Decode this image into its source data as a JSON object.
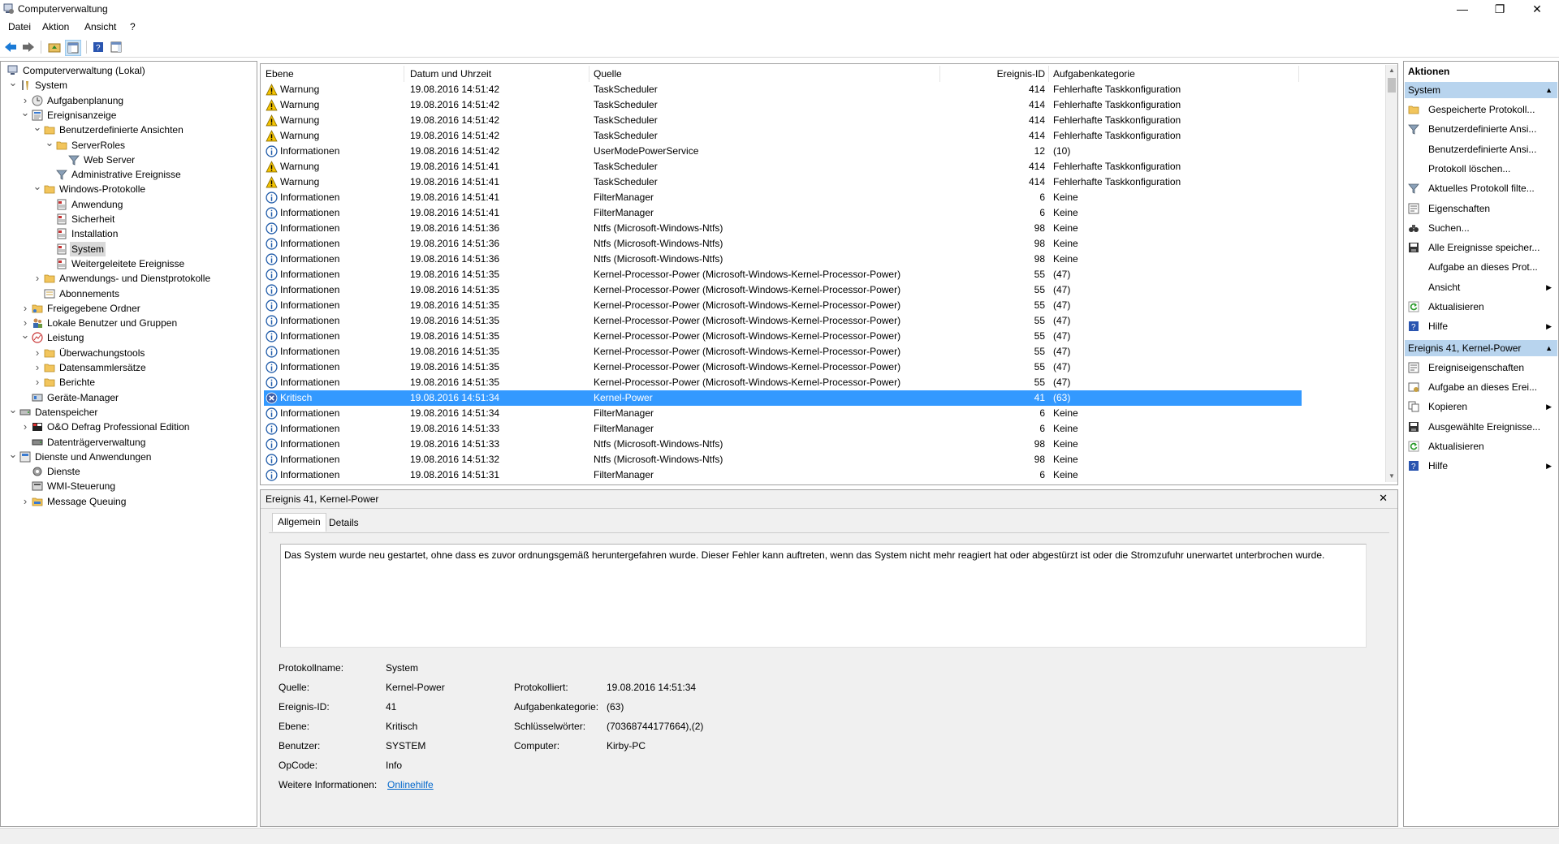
{
  "window": {
    "title": "Computerverwaltung",
    "minimize": "—",
    "maximize": "❐",
    "close": "✕"
  },
  "menu": [
    "Datei",
    "Aktion",
    "Ansicht",
    "?"
  ],
  "tree": [
    {
      "label": "Computerverwaltung (Lokal)",
      "level": 0,
      "exp": "",
      "icon": "computer-icon"
    },
    {
      "label": "System",
      "level": 1,
      "exp": "v",
      "icon": "tools-icon"
    },
    {
      "label": "Aufgabenplanung",
      "level": 2,
      "exp": ">",
      "icon": "clock-icon"
    },
    {
      "label": "Ereignisanzeige",
      "level": 2,
      "exp": "v",
      "icon": "event-viewer-icon"
    },
    {
      "label": "Benutzerdefinierte Ansichten",
      "level": 3,
      "exp": "v",
      "icon": "folder-icon"
    },
    {
      "label": "ServerRoles",
      "level": 4,
      "exp": "v",
      "icon": "folder-icon"
    },
    {
      "label": "Web Server",
      "level": 5,
      "exp": "",
      "icon": "filter-icon"
    },
    {
      "label": "Administrative Ereignisse",
      "level": 4,
      "exp": "",
      "icon": "filter-icon"
    },
    {
      "label": "Windows-Protokolle",
      "level": 3,
      "exp": "v",
      "icon": "log-folder-icon"
    },
    {
      "label": "Anwendung",
      "level": 4,
      "exp": "",
      "icon": "log-icon"
    },
    {
      "label": "Sicherheit",
      "level": 4,
      "exp": "",
      "icon": "log-icon"
    },
    {
      "label": "Installation",
      "level": 4,
      "exp": "",
      "icon": "log-icon"
    },
    {
      "label": "System",
      "level": 4,
      "exp": "",
      "icon": "log-icon",
      "selected": true
    },
    {
      "label": "Weitergeleitete Ereignisse",
      "level": 4,
      "exp": "",
      "icon": "log-icon"
    },
    {
      "label": "Anwendungs- und Dienstprotokolle",
      "level": 3,
      "exp": ">",
      "icon": "folder-icon"
    },
    {
      "label": "Abonnements",
      "level": 3,
      "exp": "",
      "icon": "subscription-icon"
    },
    {
      "label": "Freigegebene Ordner",
      "level": 2,
      "exp": ">",
      "icon": "shared-folder-icon"
    },
    {
      "label": "Lokale Benutzer und Gruppen",
      "level": 2,
      "exp": ">",
      "icon": "users-icon"
    },
    {
      "label": "Leistung",
      "level": 2,
      "exp": "v",
      "icon": "performance-icon"
    },
    {
      "label": "Überwachungstools",
      "level": 3,
      "exp": ">",
      "icon": "folder-icon"
    },
    {
      "label": "Datensammlersätze",
      "level": 3,
      "exp": ">",
      "icon": "folder-icon"
    },
    {
      "label": "Berichte",
      "level": 3,
      "exp": ">",
      "icon": "folder-icon"
    },
    {
      "label": "Geräte-Manager",
      "level": 2,
      "exp": "",
      "icon": "device-manager-icon"
    },
    {
      "label": "Datenspeicher",
      "level": 1,
      "exp": "v",
      "icon": "storage-icon"
    },
    {
      "label": "O&O Defrag Professional Edition",
      "level": 2,
      "exp": ">",
      "icon": "defrag-icon"
    },
    {
      "label": "Datenträgerverwaltung",
      "level": 2,
      "exp": "",
      "icon": "disk-icon"
    },
    {
      "label": "Dienste und Anwendungen",
      "level": 1,
      "exp": "v",
      "icon": "services-apps-icon"
    },
    {
      "label": "Dienste",
      "level": 2,
      "exp": "",
      "icon": "gear-icon"
    },
    {
      "label": "WMI-Steuerung",
      "level": 2,
      "exp": "",
      "icon": "wmi-icon"
    },
    {
      "label": "Message Queuing",
      "level": 2,
      "exp": ">",
      "icon": "queue-icon"
    }
  ],
  "columns": [
    "Ebene",
    "Datum und Uhrzeit",
    "Quelle",
    "Ereignis-ID",
    "Aufgabenkategorie"
  ],
  "events": [
    {
      "level": "Warnung",
      "type": "warn",
      "date": "19.08.2016 14:51:42",
      "source": "TaskScheduler",
      "id": "414",
      "cat": "Fehlerhafte Taskkonfiguration"
    },
    {
      "level": "Warnung",
      "type": "warn",
      "date": "19.08.2016 14:51:42",
      "source": "TaskScheduler",
      "id": "414",
      "cat": "Fehlerhafte Taskkonfiguration"
    },
    {
      "level": "Warnung",
      "type": "warn",
      "date": "19.08.2016 14:51:42",
      "source": "TaskScheduler",
      "id": "414",
      "cat": "Fehlerhafte Taskkonfiguration"
    },
    {
      "level": "Warnung",
      "type": "warn",
      "date": "19.08.2016 14:51:42",
      "source": "TaskScheduler",
      "id": "414",
      "cat": "Fehlerhafte Taskkonfiguration"
    },
    {
      "level": "Informationen",
      "type": "info",
      "date": "19.08.2016 14:51:42",
      "source": "UserModePowerService",
      "id": "12",
      "cat": "(10)"
    },
    {
      "level": "Warnung",
      "type": "warn",
      "date": "19.08.2016 14:51:41",
      "source": "TaskScheduler",
      "id": "414",
      "cat": "Fehlerhafte Taskkonfiguration"
    },
    {
      "level": "Warnung",
      "type": "warn",
      "date": "19.08.2016 14:51:41",
      "source": "TaskScheduler",
      "id": "414",
      "cat": "Fehlerhafte Taskkonfiguration"
    },
    {
      "level": "Informationen",
      "type": "info",
      "date": "19.08.2016 14:51:41",
      "source": "FilterManager",
      "id": "6",
      "cat": "Keine"
    },
    {
      "level": "Informationen",
      "type": "info",
      "date": "19.08.2016 14:51:41",
      "source": "FilterManager",
      "id": "6",
      "cat": "Keine"
    },
    {
      "level": "Informationen",
      "type": "info",
      "date": "19.08.2016 14:51:36",
      "source": "Ntfs (Microsoft-Windows-Ntfs)",
      "id": "98",
      "cat": "Keine"
    },
    {
      "level": "Informationen",
      "type": "info",
      "date": "19.08.2016 14:51:36",
      "source": "Ntfs (Microsoft-Windows-Ntfs)",
      "id": "98",
      "cat": "Keine"
    },
    {
      "level": "Informationen",
      "type": "info",
      "date": "19.08.2016 14:51:36",
      "source": "Ntfs (Microsoft-Windows-Ntfs)",
      "id": "98",
      "cat": "Keine"
    },
    {
      "level": "Informationen",
      "type": "info",
      "date": "19.08.2016 14:51:35",
      "source": "Kernel-Processor-Power (Microsoft-Windows-Kernel-Processor-Power)",
      "id": "55",
      "cat": "(47)"
    },
    {
      "level": "Informationen",
      "type": "info",
      "date": "19.08.2016 14:51:35",
      "source": "Kernel-Processor-Power (Microsoft-Windows-Kernel-Processor-Power)",
      "id": "55",
      "cat": "(47)"
    },
    {
      "level": "Informationen",
      "type": "info",
      "date": "19.08.2016 14:51:35",
      "source": "Kernel-Processor-Power (Microsoft-Windows-Kernel-Processor-Power)",
      "id": "55",
      "cat": "(47)"
    },
    {
      "level": "Informationen",
      "type": "info",
      "date": "19.08.2016 14:51:35",
      "source": "Kernel-Processor-Power (Microsoft-Windows-Kernel-Processor-Power)",
      "id": "55",
      "cat": "(47)"
    },
    {
      "level": "Informationen",
      "type": "info",
      "date": "19.08.2016 14:51:35",
      "source": "Kernel-Processor-Power (Microsoft-Windows-Kernel-Processor-Power)",
      "id": "55",
      "cat": "(47)"
    },
    {
      "level": "Informationen",
      "type": "info",
      "date": "19.08.2016 14:51:35",
      "source": "Kernel-Processor-Power (Microsoft-Windows-Kernel-Processor-Power)",
      "id": "55",
      "cat": "(47)"
    },
    {
      "level": "Informationen",
      "type": "info",
      "date": "19.08.2016 14:51:35",
      "source": "Kernel-Processor-Power (Microsoft-Windows-Kernel-Processor-Power)",
      "id": "55",
      "cat": "(47)"
    },
    {
      "level": "Informationen",
      "type": "info",
      "date": "19.08.2016 14:51:35",
      "source": "Kernel-Processor-Power (Microsoft-Windows-Kernel-Processor-Power)",
      "id": "55",
      "cat": "(47)"
    },
    {
      "level": "Kritisch",
      "type": "crit",
      "date": "19.08.2016 14:51:34",
      "source": "Kernel-Power",
      "id": "41",
      "cat": "(63)",
      "selected": true
    },
    {
      "level": "Informationen",
      "type": "info",
      "date": "19.08.2016 14:51:34",
      "source": "FilterManager",
      "id": "6",
      "cat": "Keine"
    },
    {
      "level": "Informationen",
      "type": "info",
      "date": "19.08.2016 14:51:33",
      "source": "FilterManager",
      "id": "6",
      "cat": "Keine"
    },
    {
      "level": "Informationen",
      "type": "info",
      "date": "19.08.2016 14:51:33",
      "source": "Ntfs (Microsoft-Windows-Ntfs)",
      "id": "98",
      "cat": "Keine"
    },
    {
      "level": "Informationen",
      "type": "info",
      "date": "19.08.2016 14:51:32",
      "source": "Ntfs (Microsoft-Windows-Ntfs)",
      "id": "98",
      "cat": "Keine"
    },
    {
      "level": "Informationen",
      "type": "info",
      "date": "19.08.2016 14:51:31",
      "source": "FilterManager",
      "id": "6",
      "cat": "Keine"
    }
  ],
  "detail": {
    "title": "Ereignis 41, Kernel-Power",
    "close": "✕",
    "tabs": [
      "Allgemein",
      "Details"
    ],
    "description": "Das System wurde neu gestartet, ohne dass es zuvor ordnungsgemäß heruntergefahren wurde. Dieser Fehler kann auftreten, wenn das System nicht mehr reagiert hat oder abgestürzt ist oder die Stromzufuhr unerwartet unterbrochen wurde.",
    "props_left": [
      {
        "label": "Protokollname:",
        "value": "System"
      },
      {
        "label": "Quelle:",
        "value": "Kernel-Power"
      },
      {
        "label": "Ereignis-ID:",
        "value": "41"
      },
      {
        "label": "Ebene:",
        "value": "Kritisch"
      },
      {
        "label": "Benutzer:",
        "value": "SYSTEM"
      },
      {
        "label": "OpCode:",
        "value": "Info"
      },
      {
        "label": "Weitere Informationen:",
        "value": "Onlinehilfe",
        "link": true
      }
    ],
    "props_right": [
      {
        "label": "Protokolliert:",
        "value": "19.08.2016 14:51:34"
      },
      {
        "label": "Aufgabenkategorie:",
        "value": "(63)"
      },
      {
        "label": "Schlüsselwörter:",
        "value": "(70368744177664),(2)"
      },
      {
        "label": "Computer:",
        "value": "Kirby-PC"
      }
    ]
  },
  "actions": {
    "header": "Aktionen",
    "section1": "System",
    "items1": [
      {
        "label": "Gespeicherte Protokoll...",
        "icon": "open-log-icon"
      },
      {
        "label": "Benutzerdefinierte Ansi...",
        "icon": "filter-icon"
      },
      {
        "label": "Benutzerdefinierte Ansi...",
        "icon": ""
      },
      {
        "label": "Protokoll löschen...",
        "icon": ""
      },
      {
        "label": "Aktuelles Protokoll filte...",
        "icon": "filter-icon"
      },
      {
        "label": "Eigenschaften",
        "icon": "properties-icon"
      },
      {
        "label": "Suchen...",
        "icon": "binoculars-icon"
      },
      {
        "label": "Alle Ereignisse speicher...",
        "icon": "save-icon"
      },
      {
        "label": "Aufgabe an dieses Prot...",
        "icon": ""
      },
      {
        "label": "Ansicht",
        "icon": "",
        "sub": true
      },
      {
        "label": "Aktualisieren",
        "icon": "refresh-icon"
      },
      {
        "label": "Hilfe",
        "icon": "help-icon",
        "sub": true
      }
    ],
    "section2": "Ereignis 41, Kernel-Power",
    "items2": [
      {
        "label": "Ereigniseigenschaften",
        "icon": "properties-icon"
      },
      {
        "label": "Aufgabe an dieses Erei...",
        "icon": "task-icon"
      },
      {
        "label": "Kopieren",
        "icon": "copy-icon",
        "sub": true
      },
      {
        "label": "Ausgewählte Ereignisse...",
        "icon": "save-icon"
      },
      {
        "label": "Aktualisieren",
        "icon": "refresh-icon"
      },
      {
        "label": "Hilfe",
        "icon": "help-icon",
        "sub": true
      }
    ]
  },
  "colors": {
    "selection": "#3399ff",
    "section_header": "#b8d4ee",
    "link": "#0066cc",
    "warning": "#f5c400",
    "info": "#1e5aa8",
    "critical": "#3b5ca8"
  }
}
